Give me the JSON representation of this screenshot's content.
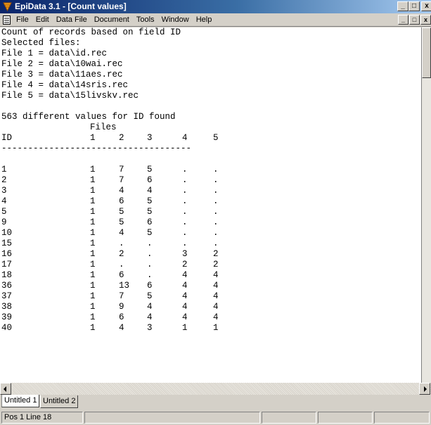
{
  "window": {
    "title": "EpiData 3.1 - [Count values]",
    "buttons": {
      "minimize": "_",
      "maximize": "□",
      "close": "x"
    }
  },
  "menubar": {
    "items": [
      "File",
      "Edit",
      "Data File",
      "Document",
      "Tools",
      "Window",
      "Help"
    ]
  },
  "document": {
    "header_lines": [
      "Count of records based on field ID",
      "Selected files:",
      "File 1 = data\\id.rec",
      "File 2 = data\\10wai.rec",
      "File 3 = data\\11aes.rec",
      "File 4 = data\\14sris.rec",
      "File 5 = data\\15livskv.rec"
    ],
    "summary": "563 different values for ID found",
    "files_label": "Files",
    "id_label": "ID",
    "file_columns": [
      "1",
      "2",
      "3",
      "4",
      "5"
    ],
    "separator": "------------------------------------",
    "rows": [
      {
        "id": "1",
        "counts": [
          "1",
          "7",
          "5",
          ".",
          "."
        ]
      },
      {
        "id": "2",
        "counts": [
          "1",
          "7",
          "6",
          ".",
          "."
        ]
      },
      {
        "id": "3",
        "counts": [
          "1",
          "4",
          "4",
          ".",
          "."
        ]
      },
      {
        "id": "4",
        "counts": [
          "1",
          "6",
          "5",
          ".",
          "."
        ]
      },
      {
        "id": "5",
        "counts": [
          "1",
          "5",
          "5",
          ".",
          "."
        ]
      },
      {
        "id": "9",
        "counts": [
          "1",
          "5",
          "6",
          ".",
          "."
        ]
      },
      {
        "id": "10",
        "counts": [
          "1",
          "4",
          "5",
          ".",
          "."
        ]
      },
      {
        "id": "15",
        "counts": [
          "1",
          ".",
          ".",
          ".",
          "."
        ]
      },
      {
        "id": "16",
        "counts": [
          "1",
          "2",
          ".",
          "3",
          "2"
        ]
      },
      {
        "id": "17",
        "counts": [
          "1",
          ".",
          ".",
          "2",
          "2"
        ]
      },
      {
        "id": "18",
        "counts": [
          "1",
          "6",
          ".",
          "4",
          "4"
        ]
      },
      {
        "id": "36",
        "counts": [
          "1",
          "13",
          "6",
          "4",
          "4"
        ]
      },
      {
        "id": "37",
        "counts": [
          "1",
          "7",
          "5",
          "4",
          "4"
        ]
      },
      {
        "id": "38",
        "counts": [
          "1",
          "9",
          "4",
          "4",
          "4"
        ]
      },
      {
        "id": "39",
        "counts": [
          "1",
          "6",
          "4",
          "4",
          "4"
        ]
      },
      {
        "id": "40",
        "counts": [
          "1",
          "4",
          "3",
          "1",
          "1"
        ]
      }
    ]
  },
  "tabs": [
    {
      "label": "Untitled 1",
      "active": true
    },
    {
      "label": "Untitled 2",
      "active": false
    }
  ],
  "statusbar": {
    "position": "Pos 1 Line 18"
  },
  "colors": {
    "titlebar_start": "#0a246a",
    "titlebar_end": "#a6caf0",
    "chrome": "#d4d0c8"
  }
}
